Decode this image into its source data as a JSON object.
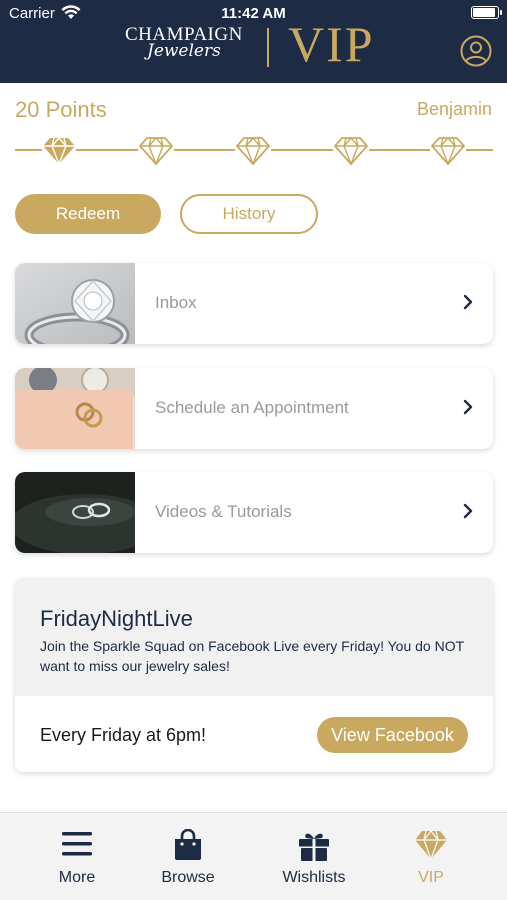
{
  "status_bar": {
    "carrier": "Carrier",
    "time": "11:42 AM"
  },
  "header": {
    "brand_line1": "CHAMPAIGN",
    "brand_line2": "Jewelers",
    "vip": "VIP",
    "profile_icon": "user-circle-icon"
  },
  "colors": {
    "navy": "#1d2b44",
    "gold": "#c9a960",
    "light_gray": "#f1f1f1"
  },
  "loyalty": {
    "points": "20 Points",
    "username": "Benjamin",
    "tier_count": 5,
    "current_tier": 1,
    "tier_icon": "diamond-icon"
  },
  "actions": {
    "redeem": "Redeem",
    "history": "History"
  },
  "menu": [
    {
      "label": "Inbox",
      "icon": "chevron-right-icon"
    },
    {
      "label": "Schedule an Appointment",
      "icon": "chevron-right-icon"
    },
    {
      "label": "Videos & Tutorials",
      "icon": "chevron-right-icon"
    }
  ],
  "event": {
    "title": "FridayNightLive",
    "description": "Join the Sparkle Squad on Facebook Live every Friday! You do NOT want to miss our jewelry sales!",
    "time": "Every Friday at 6pm!",
    "button": "View Facebook"
  },
  "tabs": [
    {
      "label": "More",
      "icon": "hamburger-menu-icon",
      "active": false
    },
    {
      "label": "Browse",
      "icon": "shopping-bag-icon",
      "active": false
    },
    {
      "label": "Wishlists",
      "icon": "gift-icon",
      "active": false
    },
    {
      "label": "VIP",
      "icon": "diamond-icon",
      "active": true
    }
  ]
}
